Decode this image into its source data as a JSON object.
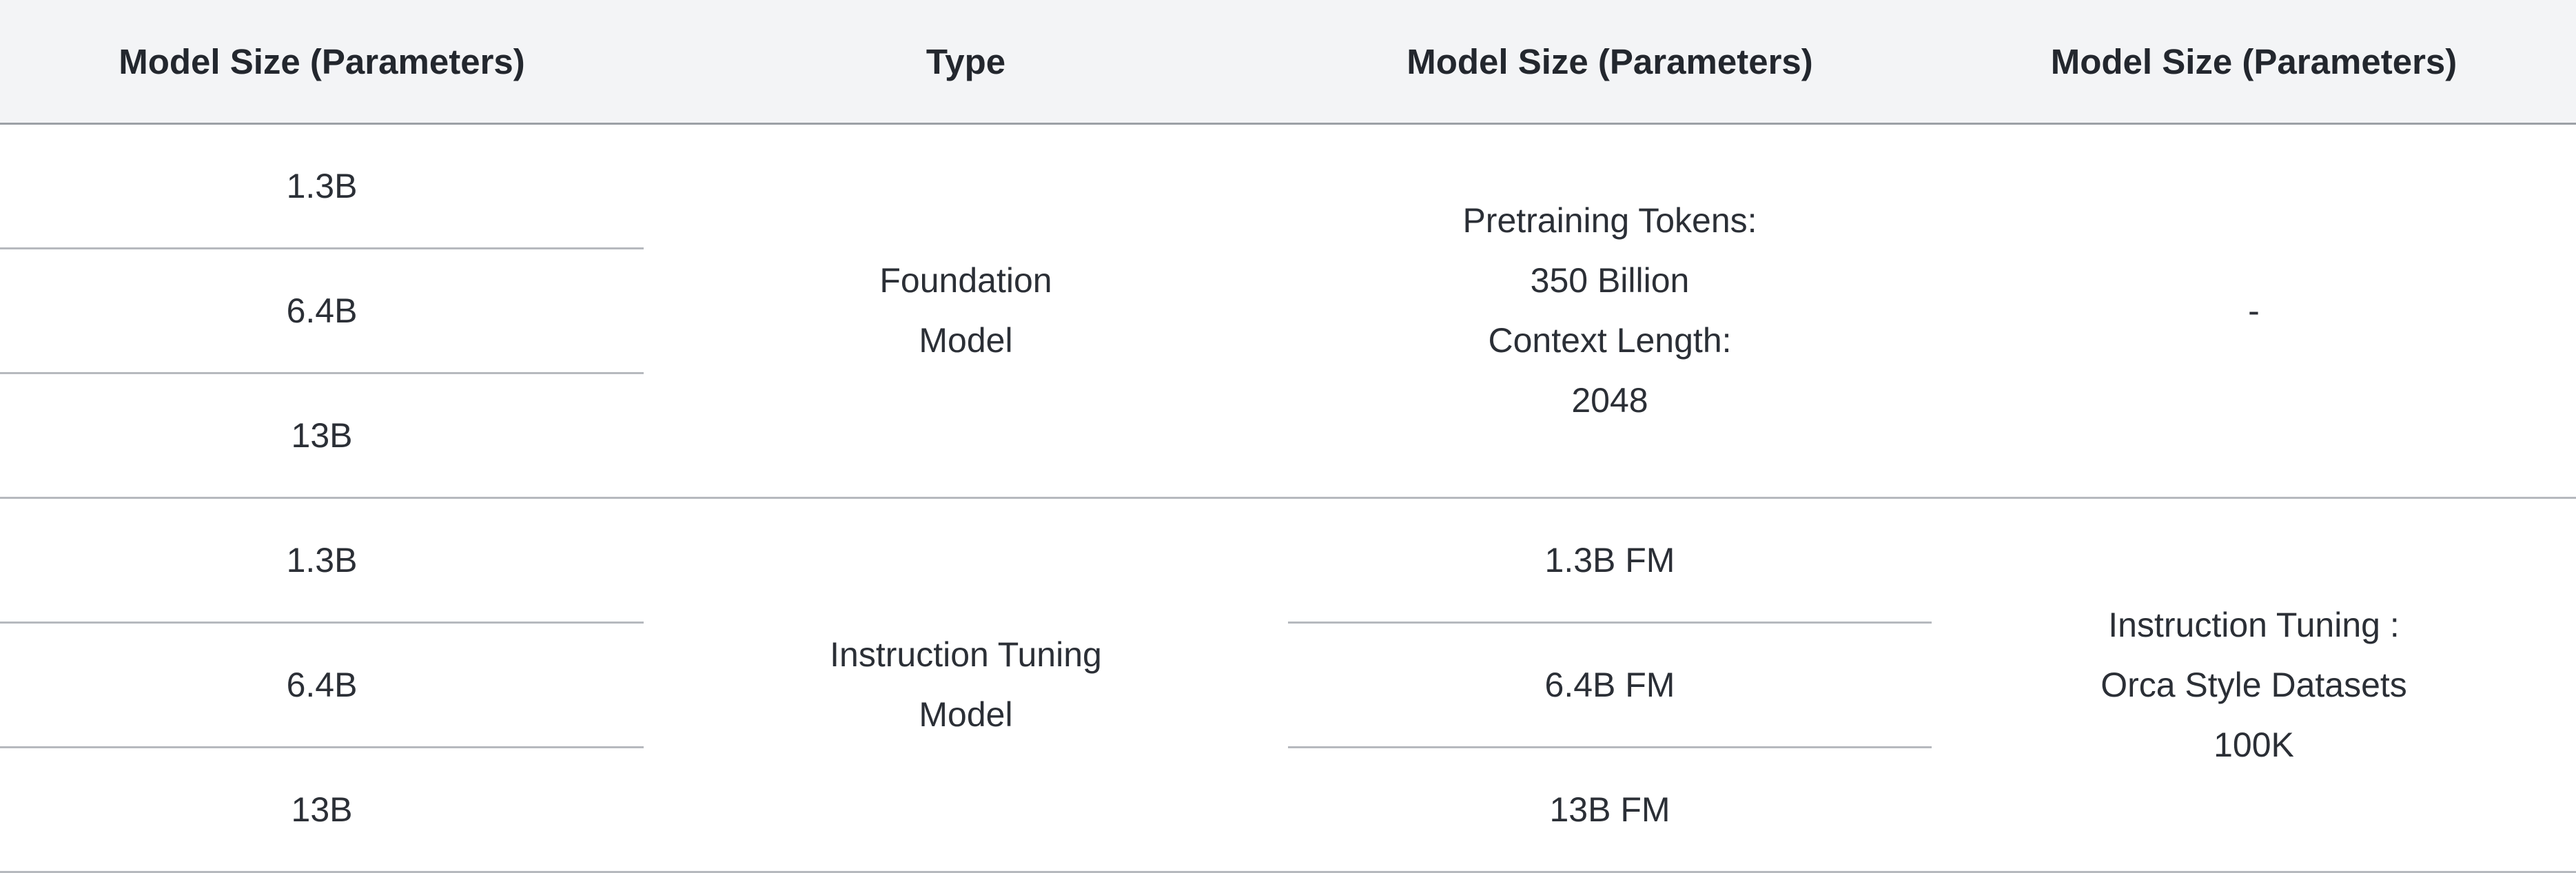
{
  "table": {
    "headers": [
      "Model Size (Parameters)",
      "Type",
      "Model Size (Parameters)",
      "Model Size (Parameters)"
    ],
    "groups": [
      {
        "sizes": [
          "1.3B",
          "6.4B",
          "13B"
        ],
        "type_lines": [
          "Foundation",
          "Model"
        ],
        "col3_lines": [
          "Pretraining Tokens:",
          "350 Billion",
          "Context Length:",
          "2048"
        ],
        "col4": "-"
      },
      {
        "sizes": [
          "1.3B",
          "6.4B",
          "13B"
        ],
        "type_lines": [
          "Instruction Tuning",
          "Model"
        ],
        "col3_items": [
          "1.3B FM",
          "6.4B FM",
          "13B FM"
        ],
        "col4_lines": [
          "Instruction Tuning :",
          "Orca Style Datasets",
          "100K"
        ]
      }
    ]
  }
}
